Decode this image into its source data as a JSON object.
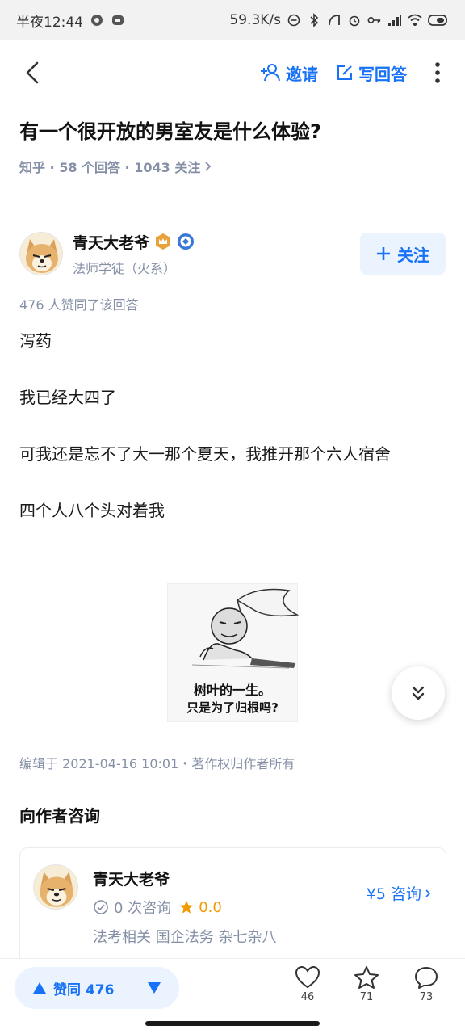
{
  "status_bar": {
    "time": "半夜12:44",
    "network_speed": "59.3K/s"
  },
  "nav": {
    "invite_label": "邀请",
    "write_answer_label": "写回答"
  },
  "question": {
    "title": "有一个很开放的男室友是什么体验?",
    "meta": "知乎 · 58 个回答 · 1043 关注"
  },
  "author": {
    "name": "青天大老爷",
    "tagline": "法师学徒（火系）",
    "follow_label": "关注"
  },
  "answer": {
    "likes_text": "476 人赞同了该回答",
    "paragraphs": [
      "泻药",
      "我已经大四了",
      "可我还是忘不了大一那个夏天，我推开那个六人宿舍",
      "四个人八个头对着我"
    ],
    "meme_caption_line1": "树叶的一生。",
    "meme_caption_line2": "只是为了归根吗?",
    "edit_info": "编辑于 2021-04-16 10:01・著作权归作者所有"
  },
  "consult": {
    "section_title": "向作者咨询",
    "name": "青天大老爷",
    "consult_count": "0 次咨询",
    "rating": "0.0",
    "tags": "法考相关 国企法务 杂七杂八",
    "price_label": "¥5 咨询"
  },
  "bottom_bar": {
    "vote_label": "赞同 476",
    "likes_count": "46",
    "favorites_count": "71",
    "comments_count": "73"
  },
  "colors": {
    "accent": "#1772f6",
    "muted": "#8590a6",
    "vote_bg": "#ebf3ff",
    "rating": "#f09b00"
  },
  "icons": {
    "nav": [
      "back-arrow-icon",
      "add-user-icon",
      "edit-icon",
      "more-vertical-icon"
    ],
    "bottom": [
      "heart-icon",
      "star-icon",
      "comment-icon"
    ]
  }
}
